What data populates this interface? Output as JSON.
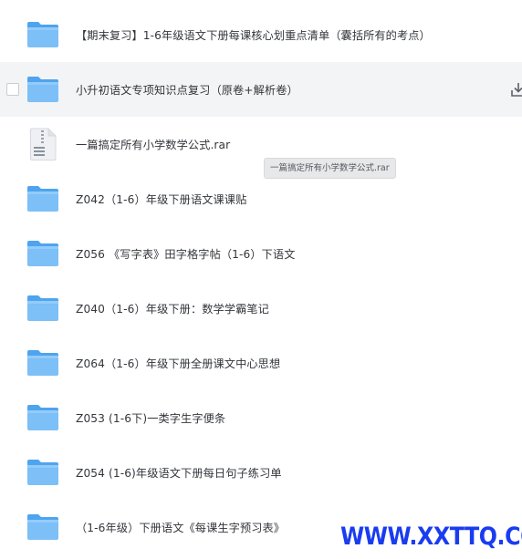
{
  "files": [
    {
      "name": "【期末复习】1-6年级语文下册每课核心划重点清单（囊括所有的考点）",
      "type": "folder"
    },
    {
      "name": "小升初语文专项知识点复习（原卷+解析卷）",
      "type": "folder",
      "hovered": true
    },
    {
      "name": "一篇搞定所有小学数学公式.rar",
      "type": "archive"
    },
    {
      "name": "Z042（1-6）年级下册语文课课贴",
      "type": "folder"
    },
    {
      "name": "Z056 《写字表》田字格字帖（1-6）下语文",
      "type": "folder"
    },
    {
      "name": "Z040（1-6）年级下册：数学学霸笔记",
      "type": "folder"
    },
    {
      "name": "Z064（1-6）年级下册全册课文中心思想",
      "type": "folder"
    },
    {
      "name": "Z053 (1-6下)一类字生字便条",
      "type": "folder"
    },
    {
      "name": "Z054 (1-6)年级语文下册每日句子练习单",
      "type": "folder"
    },
    {
      "name": "（1-6年级）下册语文《每课生字预习表》",
      "type": "folder"
    }
  ],
  "tooltip": {
    "text": "一篇搞定所有小学数学公式.rar"
  },
  "watermark": {
    "text": "WWW.XXTTQ.COM"
  },
  "icons": {
    "folder": "folder-icon",
    "archive": "archive-file-icon",
    "download": "download-icon"
  },
  "colors": {
    "folder": "#6cb7f5",
    "folder_tab": "#8ac7f8",
    "hover_row": "#f3f4f6",
    "watermark": "#1a3cf0"
  }
}
